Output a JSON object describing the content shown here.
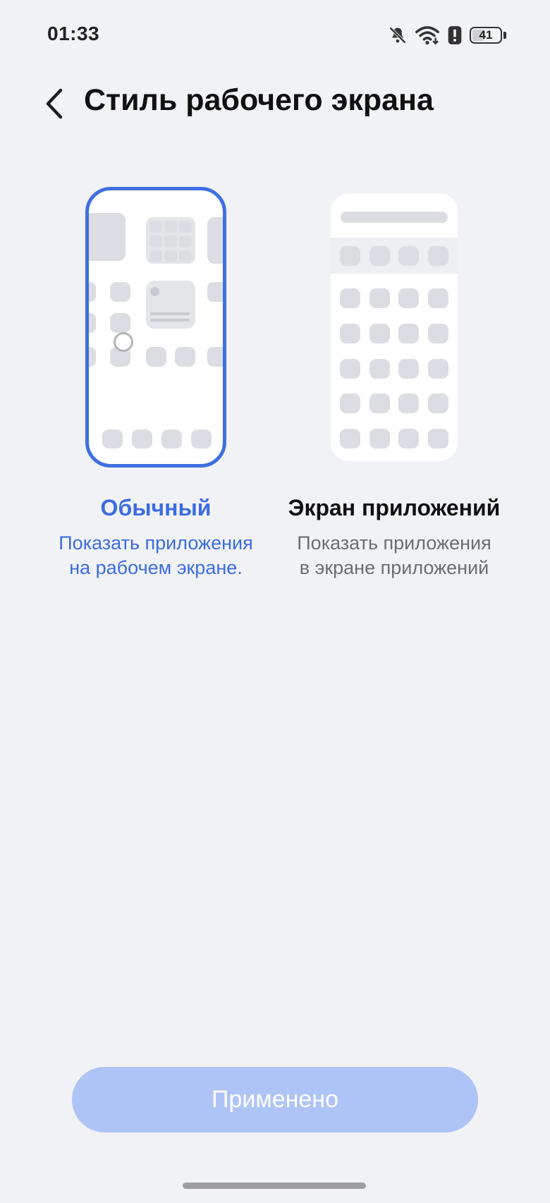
{
  "status_bar": {
    "time": "01:33",
    "battery_level": "41",
    "icons": [
      "bell-muted-icon",
      "wifi-icon",
      "alert-icon",
      "battery-icon"
    ]
  },
  "header": {
    "title": "Стиль рабочего экрана",
    "back_icon": "chevron-left-icon"
  },
  "options": [
    {
      "title": "Обычный",
      "description_line1": "Показать приложения",
      "description_line2": "на рабочем экране.",
      "selected": true
    },
    {
      "title": "Экран приложений",
      "description_line1": "Показать приложения",
      "description_line2": "в экране приложений",
      "selected": false
    }
  ],
  "apply_button": {
    "label": "Применено",
    "enabled": false
  },
  "colors": {
    "accent": "#3f6fe0",
    "button_disabled": "#afc4f6",
    "background": "#f1f2f6"
  }
}
